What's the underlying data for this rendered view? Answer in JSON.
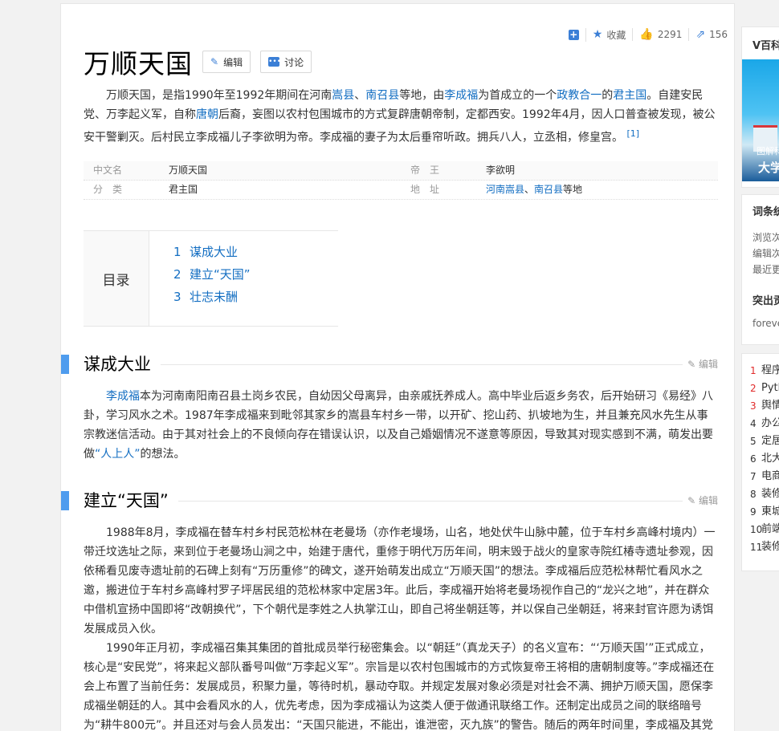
{
  "stats": {
    "collect_label": "收藏",
    "likes": "2291",
    "shares": "156"
  },
  "title": "万顺天国",
  "edit_btn": "编辑",
  "discuss_btn": "讨论",
  "summary": {
    "p1": "万顺天国，是指1990年至1992年期间在河南",
    "l1": "嵩县",
    "p2": "、",
    "l2": "南召县",
    "p3": "等地，由",
    "l3": "李成福",
    "p4": "为首成立的一个",
    "l4": "政教合一",
    "p5": "的",
    "l5": "君主国",
    "p6": "。自建安民党、万李起义军，自称",
    "l6": "唐朝",
    "p7": "后裔，妄图以农村包围城市的方式复辟唐朝帝制，定都西安。1992年4月，因人口普查被发现，被公安干警剿灭。后村民立李成福儿子李欲明为帝。李成福的妻子为太后垂帘听政。拥兵八人，立丞相，修皇宫。",
    "ref": "[1]"
  },
  "infobox": {
    "k1": "中文名",
    "v1": "万顺天国",
    "k2": "帝　王",
    "v2": "李欲明",
    "k3": "分　类",
    "v3": "君主国",
    "k4": "地　址",
    "v4a": "河南嵩县",
    "v4b": "、",
    "v4c": "南召县",
    "v4d": "等地"
  },
  "toc": {
    "label": "目录",
    "items": [
      {
        "n": "1",
        "t": "谋成大业"
      },
      {
        "n": "2",
        "t": "建立“天国”"
      },
      {
        "n": "3",
        "t": "壮志未酬"
      }
    ]
  },
  "sections": {
    "s1_title": "谋成大业",
    "s2_title": "建立“天国”",
    "edit": "编辑"
  },
  "s1": {
    "link": "李成福",
    "p1": "本为河南南阳南召县土岗乡农民，自幼因父母离异，由亲戚抚养成人。高中毕业后返乡务农，后开始研习《易经》八卦，学习风水之术。1987年李成福来到毗邻其家乡的嵩县车村乡一带，以开矿、挖山药、扒坡地为生，并且兼充风水先生从事宗教迷信活动。由于其对社会上的不良倾向存在错误认识，以及自己婚姻情况不遂意等原因，导致其对现实感到不满，萌发出要做",
    "link2": "“人上人”",
    "p2": "的想法。"
  },
  "s2": {
    "para1": "1988年8月，李成福在替车村乡村民范松林在老曼场（亦作老墁场，山名，地处伏牛山脉中麓，位于车村乡高峰村境内）一带迁坟选址之际，来到位于老曼场山涧之中，始建于唐代，重修于明代万历年间，明末毁于战火的皇家寺院红椿寺遗址参观，因依稀看见废寺遗址前的石碑上刻有“万历重修”的碑文，遂开始萌发出成立“万顺天国”的想法。李成福后应范松林帮忙看风水之邀，搬进位于车村乡高峰村罗子坪居民组的范松林家中定居3年。此后，李成福开始将老曼场视作自己的“龙兴之地”，并在群众中借机宣扬中国即将“改朝换代”，下个朝代是李姓之人执掌江山，即自己将坐朝廷等，并以保自己坐朝廷，将来封官许愿为诱饵发展成员入伙。",
    "para2": "1990年正月初，李成福召集其集团的首批成员举行秘密集会。以“朝廷”（真龙天子）的名义宣布：“‘万顺天国’”正式成立，核心是“安民党”，将来起义部队番号叫做“万李起义军”。宗旨是以农村包围城市的方式恢复帝王将相的唐朝制度等。”李成福还在会上布置了当前任务：发展成员，积聚力量，等待时机，暴动夺取。并规定发展对象必须是对社会不满、拥护万顺天国，愿保李成福坐朝廷的人。其中会看风水的人，优先考虑，因为李成福认为这类人便于做通讯联络工作。还制定出成员之间的联络暗号为“耕牛800元”。并且还对与会人员发出：“天国只能进，不能出，谁泄密，灭九族”的警告。随后的两年时间里，李成福及其党羽又为万"
  },
  "sidebar": {
    "box1_title": "V百科",
    "img_cap1": "图解科",
    "img_cap2": "大学",
    "box2_title": "词条统",
    "stat1": "浏览次",
    "stat2": "编辑次",
    "stat3": "最近更",
    "box2_title2": "突出贡",
    "contributor": "foreve",
    "ranks": [
      {
        "n": "1",
        "t": "程序"
      },
      {
        "n": "2",
        "t": "Pyth"
      },
      {
        "n": "3",
        "t": "舆情"
      },
      {
        "n": "4",
        "t": "办公"
      },
      {
        "n": "5",
        "t": "定居"
      },
      {
        "n": "6",
        "t": "北大"
      },
      {
        "n": "7",
        "t": "电商"
      },
      {
        "n": "8",
        "t": "装修"
      },
      {
        "n": "9",
        "t": "東城"
      },
      {
        "n": "10",
        "t": "前端"
      },
      {
        "n": "11",
        "t": "装修"
      }
    ]
  }
}
